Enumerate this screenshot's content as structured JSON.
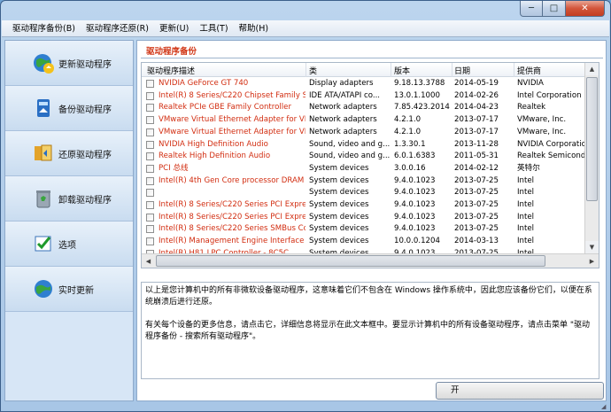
{
  "window": {
    "controls": {
      "minimize": "─",
      "maximize": "□",
      "close": "✕"
    }
  },
  "menu": [
    "驱动程序备份(B)",
    "驱动程序还原(R)",
    "更新(U)",
    "工具(T)",
    "帮助(H)"
  ],
  "sidebar": [
    {
      "label": "更新驱动程序",
      "icon": "globe-update-icon"
    },
    {
      "label": "备份驱动程序",
      "icon": "backup-icon"
    },
    {
      "label": "还原驱动程序",
      "icon": "restore-icon"
    },
    {
      "label": "卸载驱动程序",
      "icon": "recycle-bin-icon"
    },
    {
      "label": "选项",
      "icon": "options-check-icon"
    },
    {
      "label": "实时更新",
      "icon": "live-update-icon"
    }
  ],
  "main": {
    "section_title": "驱动程序备份",
    "columns": [
      "驱动程序描述",
      "类",
      "版本",
      "日期",
      "提供商"
    ],
    "rows": [
      [
        "NVIDIA GeForce GT 740",
        "Display adapters",
        "9.18.13.3788",
        "2014-05-19",
        "NVIDIA"
      ],
      [
        "Intel(R) 8 Series/C220 Chipset Family SA...",
        "IDE ATA/ATAPI co...",
        "13.0.1.1000",
        "2014-02-26",
        "Intel Corporation"
      ],
      [
        "Realtek PCIe GBE Family Controller",
        "Network adapters",
        "7.85.423.2014",
        "2014-04-23",
        "Realtek"
      ],
      [
        "VMware Virtual Ethernet Adapter for VMn...",
        "Network adapters",
        "4.2.1.0",
        "2013-07-17",
        "VMware, Inc."
      ],
      [
        "VMware Virtual Ethernet Adapter for VMn...",
        "Network adapters",
        "4.2.1.0",
        "2013-07-17",
        "VMware, Inc."
      ],
      [
        "NVIDIA High Definition Audio",
        "Sound, video and g...",
        "1.3.30.1",
        "2013-11-28",
        "NVIDIA Corporation"
      ],
      [
        "Realtek High Definition Audio",
        "Sound, video and g...",
        "6.0.1.6383",
        "2011-05-31",
        "Realtek Semiconductor"
      ],
      [
        "PCI 总线",
        "System devices",
        "3.0.0.16",
        "2014-02-12",
        "英特尔"
      ],
      [
        "Intel(R) 4th Gen Core processor DRAM C...",
        "System devices",
        "9.4.0.1023",
        "2013-07-25",
        "Intel"
      ],
      [
        "",
        "System devices",
        "9.4.0.1023",
        "2013-07-25",
        "Intel"
      ],
      [
        "Intel(R) 8 Series/C220 Series PCI Express...",
        "System devices",
        "9.4.0.1023",
        "2013-07-25",
        "Intel"
      ],
      [
        "Intel(R) 8 Series/C220 Series PCI Express...",
        "System devices",
        "9.4.0.1023",
        "2013-07-25",
        "Intel"
      ],
      [
        "Intel(R) 8 Series/C220 Series SMBus Con...",
        "System devices",
        "9.4.0.1023",
        "2013-07-25",
        "Intel"
      ],
      [
        "Intel(R) Management Engine Interface",
        "System devices",
        "10.0.0.1204",
        "2014-03-13",
        "Intel"
      ],
      [
        "Intel(R) H81 LPC Controller - 8C5C",
        "System devices",
        "9.4.0.1023",
        "2013-07-25",
        "Intel"
      ],
      [
        "VMware VMCI Host Device",
        "System devices",
        "9.5.10.0",
        "2013-02-13",
        "VMware, Inc."
      ]
    ],
    "info_paragraphs": [
      "以上是您计算机中的所有非微软设备驱动程序，这意味着它们不包含在 Windows 操作系统中，因此您应该备份它们，以便在系统崩溃后进行还原。",
      "有关每个设备的更多信息，请点击它，详细信息将显示在此文本框中。要显示计算机中的所有设备驱动程序，请点击菜单 \"驱动程序备份 - 搜索所有驱动程序\"。"
    ],
    "next_button": "开"
  }
}
